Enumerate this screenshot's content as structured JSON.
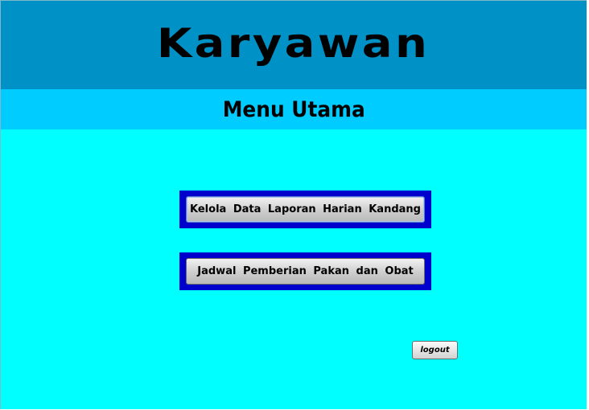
{
  "header": {
    "title": "Karyawan"
  },
  "subheader": {
    "title": "Menu Utama"
  },
  "menu": {
    "buttons": [
      {
        "label": "Kelola Data Laporan Harian Kandang"
      },
      {
        "label": "Jadwal Pemberian Pakan dan Obat"
      }
    ]
  },
  "logout": {
    "label": "logout"
  },
  "colors": {
    "header_bg": "#0092c6",
    "subheader_bg": "#00ccff",
    "page_bg": "#00ffff",
    "button_frame": "#0000cc"
  }
}
